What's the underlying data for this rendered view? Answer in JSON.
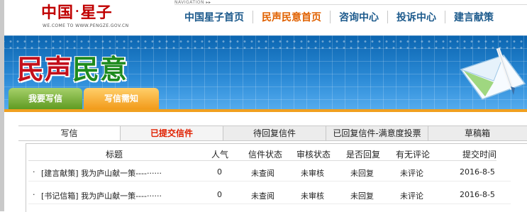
{
  "header": {
    "logo_left": "中国",
    "logo_dot": "·",
    "logo_right": "星子",
    "logo_sub": "WE.COME TO WWW.PENGZE.GOV.CN",
    "nav_label": "NAVIGATION",
    "nav_items": [
      {
        "label": "中国星子首页",
        "active": false
      },
      {
        "label": "民声民意首页",
        "active": true
      },
      {
        "label": "咨询中心",
        "active": false
      },
      {
        "label": "投诉中心",
        "active": false
      },
      {
        "label": "建言献策",
        "active": false
      }
    ]
  },
  "banner": {
    "title_part1": "民声",
    "title_part2": "民意",
    "tabs": [
      {
        "label": "我要写信",
        "style": "green"
      },
      {
        "label": "写信需知",
        "style": "orange"
      }
    ]
  },
  "tabs": [
    {
      "label": "写信"
    },
    {
      "label": "已提交信件"
    },
    {
      "label": "待回复信件"
    },
    {
      "label": "已回复信件-满意度投票"
    },
    {
      "label": "草稿箱"
    }
  ],
  "table": {
    "headers": [
      "标题",
      "人气",
      "信件状态",
      "审核状态",
      "是否回复",
      "有无评论",
      "提交时间"
    ],
    "rows": [
      {
        "bullet": "·",
        "title": "[建言献策] 我为庐山献一策----······",
        "pop": "0",
        "status": "未查阅",
        "review": "未审核",
        "reply": "未回复",
        "eval": "未评论",
        "date": "2016-8-5"
      },
      {
        "bullet": "·",
        "title": "[书记信箱] 我为庐山献一策----······",
        "pop": "0",
        "status": "未查阅",
        "review": "未审核",
        "reply": "未回复",
        "eval": "未评论",
        "date": "2016-8-5"
      }
    ]
  },
  "colors": {
    "nav_text": "#1c5a8c",
    "nav_active": "#e06100",
    "tab_active": "#e02000",
    "banner_blue": "#2b8ad6"
  }
}
